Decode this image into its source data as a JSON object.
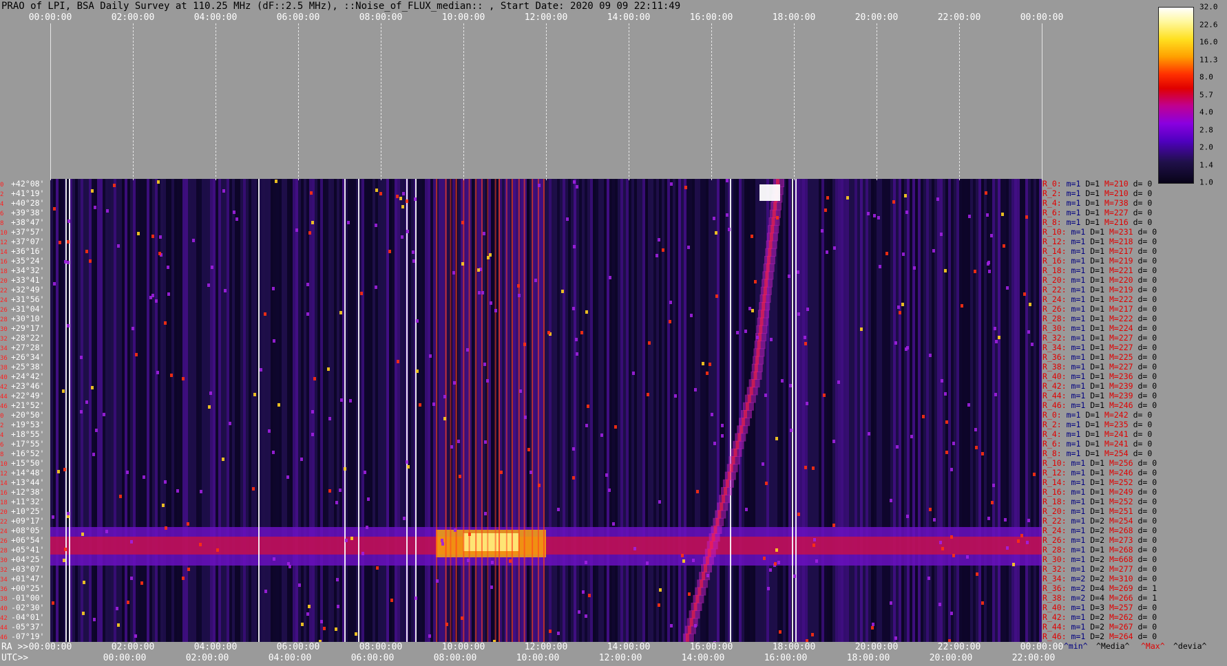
{
  "title": "PRAO of LPI, BSA Daily Survey at 110.25 MHz (dF::2.5 MHz), ::Noise_of_FLUX_median:: , Start Date: 2020 09 09 22:11:49",
  "top_axis": [
    "00:00:00",
    "02:00:00",
    "04:00:00",
    "06:00:00",
    "08:00:00",
    "10:00:00",
    "12:00:00",
    "14:00:00",
    "16:00:00",
    "18:00:00",
    "20:00:00",
    "22:00:00",
    "00:00:00"
  ],
  "ra_axis": {
    "name": "RA >>",
    "labels": [
      "00:00:00",
      "02:00:00",
      "04:00:00",
      "06:00:00",
      "08:00:00",
      "10:00:00",
      "12:00:00",
      "14:00:00",
      "16:00:00",
      "18:00:00",
      "20:00:00",
      "22:00:00",
      "00:00:00"
    ]
  },
  "utc_axis": {
    "name": "UTC>>",
    "labels": [
      "00:00:00",
      "02:00:00",
      "04:00:00",
      "06:00:00",
      "08:00:00",
      "10:00:00",
      "12:00:00",
      "14:00:00",
      "16:00:00",
      "18:00:00",
      "20:00:00",
      "22:00:00"
    ]
  },
  "colorbar": {
    "labels": [
      "32.0",
      "22.6",
      "16.0",
      "11.3",
      "8.0",
      "5.7",
      "4.0",
      "2.8",
      "2.0",
      "1.4",
      "1.0"
    ]
  },
  "stat_headers": {
    "min": "^min^",
    "median": "^Media^",
    "max": "^Max^",
    "dev": "^devia^"
  },
  "rows": [
    {
      "idx": "0",
      "dec": "+42°08'",
      "beam": "R_0:",
      "m": "m=1",
      "D": "D=1",
      "M": "M=210",
      "d": "d= 0"
    },
    {
      "idx": "2",
      "dec": "+41°19'",
      "beam": "R_2:",
      "m": "m=1",
      "D": "D=1",
      "M": "M=210",
      "d": "d= 0"
    },
    {
      "idx": "4",
      "dec": "+40°28'",
      "beam": "R_4:",
      "m": "m=1",
      "D": "D=1",
      "M": "M=738",
      "d": "d= 0"
    },
    {
      "idx": "6",
      "dec": "+39°38'",
      "beam": "R_6:",
      "m": "m=1",
      "D": "D=1",
      "M": "M=227",
      "d": "d= 0"
    },
    {
      "idx": "8",
      "dec": "+38°47'",
      "beam": "R_8:",
      "m": "m=1",
      "D": "D=1",
      "M": "M=216",
      "d": "d= 0"
    },
    {
      "idx": "10",
      "dec": "+37°57'",
      "beam": "R_10:",
      "m": "m=1",
      "D": "D=1",
      "M": "M=231",
      "d": "d= 0"
    },
    {
      "idx": "12",
      "dec": "+37°07'",
      "beam": "R_12:",
      "m": "m=1",
      "D": "D=1",
      "M": "M=218",
      "d": "d= 0"
    },
    {
      "idx": "14",
      "dec": "+36°16'",
      "beam": "R_14:",
      "m": "m=1",
      "D": "D=1",
      "M": "M=217",
      "d": "d= 0"
    },
    {
      "idx": "16",
      "dec": "+35°24'",
      "beam": "R_16:",
      "m": "m=1",
      "D": "D=1",
      "M": "M=219",
      "d": "d= 0"
    },
    {
      "idx": "18",
      "dec": "+34°32'",
      "beam": "R_18:",
      "m": "m=1",
      "D": "D=1",
      "M": "M=221",
      "d": "d= 0"
    },
    {
      "idx": "20",
      "dec": "+33°41'",
      "beam": "R_20:",
      "m": "m=1",
      "D": "D=1",
      "M": "M=220",
      "d": "d= 0"
    },
    {
      "idx": "22",
      "dec": "+32°49'",
      "beam": "R_22:",
      "m": "m=1",
      "D": "D=1",
      "M": "M=219",
      "d": "d= 0"
    },
    {
      "idx": "24",
      "dec": "+31°56'",
      "beam": "R_24:",
      "m": "m=1",
      "D": "D=1",
      "M": "M=222",
      "d": "d= 0"
    },
    {
      "idx": "26",
      "dec": "+31°04'",
      "beam": "R_26:",
      "m": "m=1",
      "D": "D=1",
      "M": "M=217",
      "d": "d= 0"
    },
    {
      "idx": "28",
      "dec": "+30°10'",
      "beam": "R_28:",
      "m": "m=1",
      "D": "D=1",
      "M": "M=222",
      "d": "d= 0"
    },
    {
      "idx": "30",
      "dec": "+29°17'",
      "beam": "R_30:",
      "m": "m=1",
      "D": "D=1",
      "M": "M=224",
      "d": "d= 0"
    },
    {
      "idx": "32",
      "dec": "+28°22'",
      "beam": "R_32:",
      "m": "m=1",
      "D": "D=1",
      "M": "M=227",
      "d": "d= 0"
    },
    {
      "idx": "34",
      "dec": "+27°28'",
      "beam": "R_34:",
      "m": "m=1",
      "D": "D=1",
      "M": "M=227",
      "d": "d= 0"
    },
    {
      "idx": "36",
      "dec": "+26°34'",
      "beam": "R_36:",
      "m": "m=1",
      "D": "D=1",
      "M": "M=225",
      "d": "d= 0"
    },
    {
      "idx": "38",
      "dec": "+25°38'",
      "beam": "R_38:",
      "m": "m=1",
      "D": "D=1",
      "M": "M=227",
      "d": "d= 0"
    },
    {
      "idx": "40",
      "dec": "+24°42'",
      "beam": "R_40:",
      "m": "m=1",
      "D": "D=1",
      "M": "M=236",
      "d": "d= 0"
    },
    {
      "idx": "42",
      "dec": "+23°46'",
      "beam": "R_42:",
      "m": "m=1",
      "D": "D=1",
      "M": "M=239",
      "d": "d= 0"
    },
    {
      "idx": "44",
      "dec": "+22°49'",
      "beam": "R_44:",
      "m": "m=1",
      "D": "D=1",
      "M": "M=239",
      "d": "d= 0"
    },
    {
      "idx": "46",
      "dec": "+21°52'",
      "beam": "R_46:",
      "m": "m=1",
      "D": "D=1",
      "M": "M=246",
      "d": "d= 0"
    },
    {
      "idx": "0",
      "dec": "+20°50'",
      "beam": "R_0:",
      "m": "m=1",
      "D": "D=1",
      "M": "M=242",
      "d": "d= 0"
    },
    {
      "idx": "2",
      "dec": "+19°53'",
      "beam": "R_2:",
      "m": "m=1",
      "D": "D=1",
      "M": "M=235",
      "d": "d= 0"
    },
    {
      "idx": "4",
      "dec": "+18°55'",
      "beam": "R_4:",
      "m": "m=1",
      "D": "D=1",
      "M": "M=241",
      "d": "d= 0"
    },
    {
      "idx": "6",
      "dec": "+17°55'",
      "beam": "R_6:",
      "m": "m=1",
      "D": "D=1",
      "M": "M=241",
      "d": "d= 0"
    },
    {
      "idx": "8",
      "dec": "+16°52'",
      "beam": "R_8:",
      "m": "m=1",
      "D": "D=1",
      "M": "M=254",
      "d": "d= 0"
    },
    {
      "idx": "10",
      "dec": "+15°50'",
      "beam": "R_10:",
      "m": "m=1",
      "D": "D=1",
      "M": "M=256",
      "d": "d= 0"
    },
    {
      "idx": "12",
      "dec": "+14°48'",
      "beam": "R_12:",
      "m": "m=1",
      "D": "D=1",
      "M": "M=246",
      "d": "d= 0"
    },
    {
      "idx": "14",
      "dec": "+13°44'",
      "beam": "R_14:",
      "m": "m=1",
      "D": "D=1",
      "M": "M=252",
      "d": "d= 0"
    },
    {
      "idx": "16",
      "dec": "+12°38'",
      "beam": "R_16:",
      "m": "m=1",
      "D": "D=1",
      "M": "M=249",
      "d": "d= 0"
    },
    {
      "idx": "18",
      "dec": "+11°32'",
      "beam": "R_18:",
      "m": "m=1",
      "D": "D=1",
      "M": "M=252",
      "d": "d= 0"
    },
    {
      "idx": "20",
      "dec": "+10°25'",
      "beam": "R_20:",
      "m": "m=1",
      "D": "D=1",
      "M": "M=251",
      "d": "d= 0"
    },
    {
      "idx": "22",
      "dec": "+09°17'",
      "beam": "R_22:",
      "m": "m=1",
      "D": "D=2",
      "M": "M=254",
      "d": "d= 0"
    },
    {
      "idx": "24",
      "dec": "+08°05'",
      "beam": "R_24:",
      "m": "m=1",
      "D": "D=2",
      "M": "M=268",
      "d": "d= 0"
    },
    {
      "idx": "26",
      "dec": "+06°54'",
      "beam": "R_26:",
      "m": "m=1",
      "D": "D=2",
      "M": "M=273",
      "d": "d= 0"
    },
    {
      "idx": "28",
      "dec": "+05°41'",
      "beam": "R_28:",
      "m": "m=1",
      "D": "D=1",
      "M": "M=268",
      "d": "d= 0"
    },
    {
      "idx": "30",
      "dec": "+04°25'",
      "beam": "R_30:",
      "m": "m=1",
      "D": "D=2",
      "M": "M=668",
      "d": "d= 0"
    },
    {
      "idx": "32",
      "dec": "+03°07'",
      "beam": "R_32:",
      "m": "m=1",
      "D": "D=2",
      "M": "M=277",
      "d": "d= 0"
    },
    {
      "idx": "34",
      "dec": "+01°47'",
      "beam": "R_34:",
      "m": "m=2",
      "D": "D=2",
      "M": "M=310",
      "d": "d= 0"
    },
    {
      "idx": "36",
      "dec": "+00°25'",
      "beam": "R_36:",
      "m": "m=2",
      "D": "D=4",
      "M": "M=269",
      "d": "d= 1"
    },
    {
      "idx": "38",
      "dec": "-01°00'",
      "beam": "R_38:",
      "m": "m=2",
      "D": "D=4",
      "M": "M=266",
      "d": "d= 1"
    },
    {
      "idx": "40",
      "dec": "-02°30'",
      "beam": "R_40:",
      "m": "m=1",
      "D": "D=3",
      "M": "M=257",
      "d": "d= 0"
    },
    {
      "idx": "42",
      "dec": "-04°01'",
      "beam": "R_42:",
      "m": "m=1",
      "D": "D=2",
      "M": "M=262",
      "d": "d= 0"
    },
    {
      "idx": "44",
      "dec": "-05°37'",
      "beam": "R_44:",
      "m": "m=1",
      "D": "D=2",
      "M": "M=267",
      "d": "d= 0"
    },
    {
      "idx": "46",
      "dec": "-07°19'",
      "beam": "R_46:",
      "m": "m=1",
      "D": "D=2",
      "M": "M=264",
      "d": "d= 0"
    }
  ],
  "colors": {
    "background": "#9a9a9a",
    "plot_bg": "#180a45",
    "label_red": "#ff2020",
    "label_blue": "#000080"
  }
}
